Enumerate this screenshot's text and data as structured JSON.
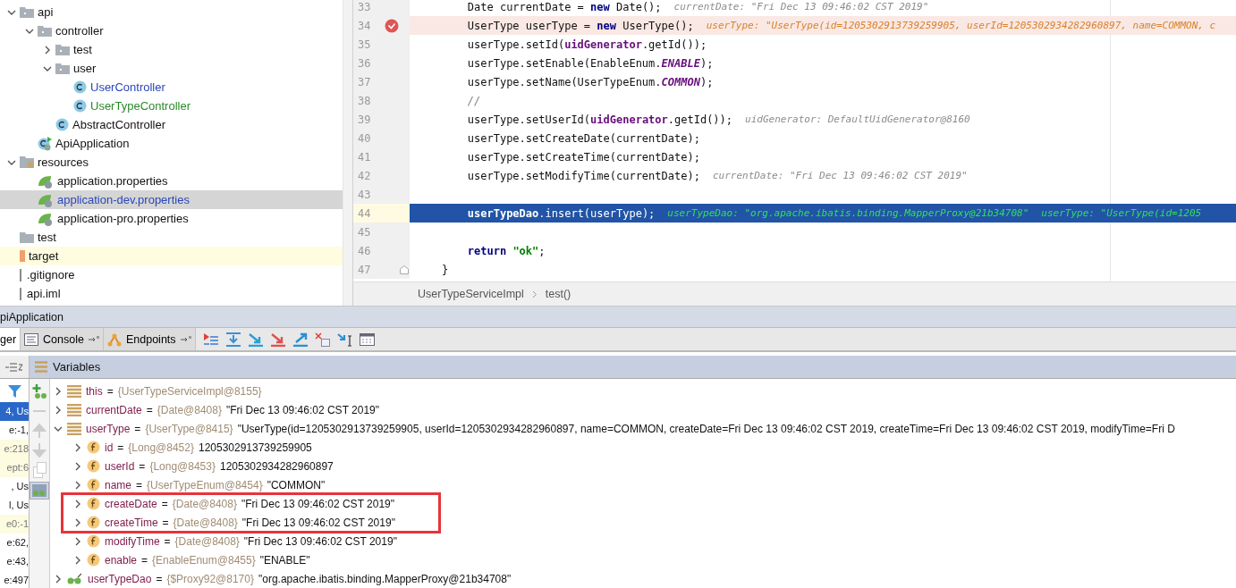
{
  "project_tree": [
    {
      "name": "api",
      "kind": "package",
      "expanded": true,
      "selected": false,
      "children": [
        {
          "name": "controller",
          "kind": "package",
          "expanded": true,
          "selected": false,
          "children": [
            {
              "name": "test",
              "kind": "package",
              "expanded": false,
              "selected": false
            },
            {
              "name": "user",
              "kind": "package",
              "expanded": true,
              "selected": false,
              "children": [
                {
                  "name": "UserController",
                  "kind": "class",
                  "selected": false,
                  "color": "#2a46b8"
                },
                {
                  "name": "UserTypeController",
                  "kind": "class",
                  "selected": false,
                  "color": "#2a8a2a"
                }
              ]
            },
            {
              "name": "AbstractController",
              "kind": "class",
              "selected": false
            }
          ]
        },
        {
          "name": "ApiApplication",
          "kind": "app",
          "selected": false
        }
      ]
    },
    {
      "name": "resources",
      "kind": "resources",
      "expanded": true,
      "selected": false,
      "children": [
        {
          "name": "application.properties",
          "kind": "properties",
          "selected": false
        },
        {
          "name": "application-dev.properties",
          "kind": "properties",
          "selected": true,
          "color": "#2a46b8"
        },
        {
          "name": "application-pro.properties",
          "kind": "properties",
          "selected": false
        }
      ]
    },
    {
      "name": "test",
      "kind": "folder",
      "selected": false
    },
    {
      "name": "target",
      "kind": "excluded",
      "selected": false
    },
    {
      "name": ".gitignore",
      "kind": "file",
      "selected": false
    },
    {
      "name": "api.iml",
      "kind": "file",
      "selected": false
    }
  ],
  "editor": {
    "lines": [
      {
        "number": "33",
        "breakpoint": false,
        "current": false,
        "tokens": [
          {
            "text": "        Date currentDate = ",
            "kind": "plain"
          },
          {
            "text": "new",
            "kind": "keyword"
          },
          {
            "text": " Date();",
            "kind": "plain"
          }
        ],
        "hints": [
          {
            "text": "currentDate: \"Fri Dec 13 09:46:02 CST 2019\"",
            "kind": "value"
          }
        ]
      },
      {
        "number": "34",
        "breakpoint": true,
        "current": false,
        "tokens": [
          {
            "text": "        UserType userType = ",
            "kind": "plain"
          },
          {
            "text": "new",
            "kind": "keyword"
          },
          {
            "text": " UserType();",
            "kind": "plain"
          }
        ],
        "hints": [
          {
            "text": "userType: \"UserType(id=1205302913739259905, userId=1205302934282960897, name=COMMON, c",
            "kind": "changed"
          }
        ]
      },
      {
        "number": "35",
        "breakpoint": false,
        "current": false,
        "tokens": [
          {
            "text": "        userType.setId(",
            "kind": "plain"
          },
          {
            "text": "uidGenerator",
            "kind": "field"
          },
          {
            "text": ".getId());",
            "kind": "plain"
          }
        ]
      },
      {
        "number": "36",
        "breakpoint": false,
        "current": false,
        "tokens": [
          {
            "text": "        userType.setEnable(EnableEnum.",
            "kind": "plain"
          },
          {
            "text": "ENABLE",
            "kind": "constant"
          },
          {
            "text": ");",
            "kind": "plain"
          }
        ]
      },
      {
        "number": "37",
        "breakpoint": false,
        "current": false,
        "tokens": [
          {
            "text": "        userType.setName(UserTypeEnum.",
            "kind": "plain"
          },
          {
            "text": "COMMON",
            "kind": "constant"
          },
          {
            "text": ");",
            "kind": "plain"
          }
        ]
      },
      {
        "number": "38",
        "breakpoint": false,
        "current": false,
        "tokens": [
          {
            "text": "        //",
            "kind": "comment"
          }
        ]
      },
      {
        "number": "39",
        "breakpoint": false,
        "current": false,
        "tokens": [
          {
            "text": "        userType.setUserId(",
            "kind": "plain"
          },
          {
            "text": "uidGenerator",
            "kind": "field"
          },
          {
            "text": ".getId());",
            "kind": "plain"
          }
        ],
        "hints": [
          {
            "text": "uidGenerator: DefaultUidGenerator@8160",
            "kind": "value"
          }
        ]
      },
      {
        "number": "40",
        "breakpoint": false,
        "current": false,
        "tokens": [
          {
            "text": "        userType.setCreateDate(currentDate);",
            "kind": "plain"
          }
        ]
      },
      {
        "number": "41",
        "breakpoint": false,
        "current": false,
        "tokens": [
          {
            "text": "        userType.setCreateTime(currentDate);",
            "kind": "plain"
          }
        ]
      },
      {
        "number": "42",
        "breakpoint": false,
        "current": false,
        "tokens": [
          {
            "text": "        userType.setModifyTime(currentDate);",
            "kind": "plain"
          }
        ],
        "hints": [
          {
            "text": "currentDate: \"Fri Dec 13 09:46:02 CST 2019\"",
            "kind": "value"
          }
        ]
      },
      {
        "number": "43",
        "breakpoint": false,
        "current": false
      },
      {
        "number": "44",
        "breakpoint": false,
        "current": true,
        "tokens": [
          {
            "text": "        userTypeDao",
            "kind": "field"
          },
          {
            "text": ".insert(userType);",
            "kind": "plain"
          }
        ],
        "hints": [
          {
            "text": "userTypeDao: \"org.apache.ibatis.binding.MapperProxy@21b34708\"",
            "kind": "value"
          },
          {
            "text": "userType: \"UserType(id=1205",
            "kind": "value"
          }
        ]
      },
      {
        "number": "45",
        "breakpoint": false,
        "current": false
      },
      {
        "number": "46",
        "breakpoint": false,
        "current": false,
        "tokens": [
          {
            "text": "        return",
            "kind": "keyword"
          },
          {
            "text": " \"ok\"",
            "kind": "string"
          },
          {
            "text": ";",
            "kind": "plain"
          }
        ]
      },
      {
        "number": "47",
        "breakpoint": false,
        "current": false,
        "fold": true,
        "tokens": [
          {
            "text": "    }",
            "kind": "plain"
          }
        ]
      }
    ],
    "breadcrumb": [
      "UserTypeServiceImpl",
      "test()"
    ]
  },
  "debug": {
    "title": "piApplication",
    "tabs": [
      {
        "label": "ger",
        "kind": "debugger",
        "selected": true
      },
      {
        "label": "Console",
        "kind": "console",
        "selected": false
      },
      {
        "label": "Endpoints",
        "kind": "endpoints",
        "selected": false
      }
    ],
    "variables_title": "Variables",
    "frames": [
      {
        "text": "4, Us",
        "selected": true,
        "library": false
      },
      {
        "text": "e:-1,",
        "selected": false,
        "library": false
      },
      {
        "text": "e:218",
        "selected": false,
        "library": true
      },
      {
        "text": "ept:6",
        "selected": false,
        "library": true
      },
      {
        "text": ", Us",
        "selected": false,
        "library": false
      },
      {
        "text": "l, Us",
        "selected": false,
        "library": false
      },
      {
        "text": "e0:-1",
        "selected": false,
        "library": true
      },
      {
        "text": "e:62,",
        "selected": false,
        "library": false
      },
      {
        "text": "e:43,",
        "selected": false,
        "library": false
      },
      {
        "text": "e:497",
        "selected": false,
        "library": false
      }
    ],
    "variables": [
      {
        "name": "this",
        "operator": "=",
        "kind": "object",
        "expanded": false,
        "type": "{UserTypeServiceImpl@8155}"
      },
      {
        "name": "currentDate",
        "operator": "=",
        "kind": "object",
        "expanded": false,
        "type": "{Date@8408}",
        "value": "\"Fri Dec 13 09:46:02 CST 2019\""
      },
      {
        "name": "userType",
        "operator": "=",
        "kind": "object",
        "expanded": true,
        "type": "{UserType@8415}",
        "value": "\"UserType(id=1205302913739259905, userId=1205302934282960897, name=COMMON, createDate=Fri Dec 13 09:46:02 CST 2019, createTime=Fri Dec 13 09:46:02 CST 2019, modifyTime=Fri D",
        "children": [
          {
            "name": "id",
            "operator": "=",
            "kind": "field",
            "expanded": false,
            "type": "{Long@8452}",
            "value": "1205302913739259905"
          },
          {
            "name": "userId",
            "operator": "=",
            "kind": "field",
            "expanded": false,
            "type": "{Long@8453}",
            "value": "1205302934282960897"
          },
          {
            "name": "name",
            "operator": "=",
            "kind": "field",
            "expanded": false,
            "type": "{UserTypeEnum@8454}",
            "value": "\"COMMON\""
          },
          {
            "name": "createDate",
            "operator": "=",
            "kind": "field",
            "expanded": false,
            "type": "{Date@8408}",
            "value": "\"Fri Dec 13 09:46:02 CST 2019\""
          },
          {
            "name": "createTime",
            "operator": "=",
            "kind": "field",
            "expanded": false,
            "type": "{Date@8408}",
            "value": "\"Fri Dec 13 09:46:02 CST 2019\""
          },
          {
            "name": "modifyTime",
            "operator": "=",
            "kind": "field",
            "expanded": false,
            "type": "{Date@8408}",
            "value": "\"Fri Dec 13 09:46:02 CST 2019\""
          },
          {
            "name": "enable",
            "operator": "=",
            "kind": "field",
            "expanded": false,
            "type": "{EnableEnum@8455}",
            "value": "\"ENABLE\""
          }
        ]
      },
      {
        "name": "userTypeDao",
        "operator": "=",
        "kind": "proxy",
        "expanded": false,
        "type": "{$Proxy92@8170}",
        "value": "\"org.apache.ibatis.binding.MapperProxy@21b34708\""
      }
    ]
  }
}
